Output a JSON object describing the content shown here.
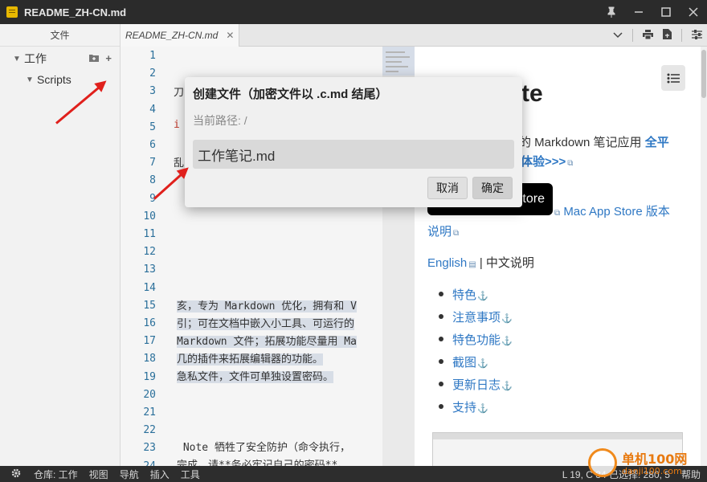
{
  "window": {
    "title": "README_ZH-CN.md",
    "controls": [
      "pin-icon",
      "minimize-icon",
      "maximize-icon",
      "close-icon"
    ]
  },
  "sidebar": {
    "header": "文件",
    "tree": [
      {
        "label": "工作",
        "expanded": true
      },
      {
        "label": "Scripts",
        "expanded": true
      }
    ]
  },
  "tabs": [
    {
      "label": "README_ZH-CN.md",
      "active": true
    }
  ],
  "editor": {
    "line_numbers": [
      "1",
      "2",
      "3",
      "4",
      "5",
      "6",
      "7",
      "8",
      "9",
      "10",
      "11",
      "12",
      "13",
      "14",
      "15",
      "16",
      "17",
      "18",
      "19",
      "20",
      "21",
      "22",
      "23",
      "24"
    ],
    "visible_text": {
      "l3": "刀",
      "l5": "i",
      "l7": "乱",
      "l15": "亥，专为 Markdown 优化，拥有和 V",
      "l16": "引；可在文档中嵌入小工具、可运行的",
      "l17": "Markdown 文件；拓展功能尽量用 Ma",
      "l18": "几的插件来拓展编辑器的功能。",
      "l19": "急私文件，文件可单独设置密码。",
      "l23": " Note 牺牲了安全防护（命令执行，",
      "l24": "完成。请**务必牢记自己的密码**。"
    }
  },
  "preview": {
    "title_fragment": "te",
    "line1": "的 Markdown 笔记应用",
    "line1_link": "全平",
    "line2_link": "体验>>>",
    "store_badge": "tore",
    "mas_link": "Mac App Store 版本",
    "mas_link2": "说明",
    "lang_english": "English",
    "lang_sep": " | 中文说明",
    "toc": [
      "特色",
      "注意事项",
      "特色功能",
      "截图",
      "更新日志",
      "支持"
    ]
  },
  "dialog": {
    "title": "创建文件（加密文件以 .c.md 结尾）",
    "path_label": "当前路径: /",
    "input_value": "工作笔记.md",
    "cancel": "取消",
    "confirm": "确定"
  },
  "statusbar": {
    "repo": "仓库: 工作",
    "view": "视图",
    "nav": "导航",
    "insert": "插入",
    "tools": "工具",
    "position": "L 19, C 34 已选择: 280, 5",
    "help": "帮助"
  },
  "watermark": {
    "main": "单机100网",
    "sub": "danji100.com"
  },
  "colors": {
    "accent_link": "#2f78c4",
    "arrow": "#e0201c",
    "line_number": "#2a6f9a"
  }
}
